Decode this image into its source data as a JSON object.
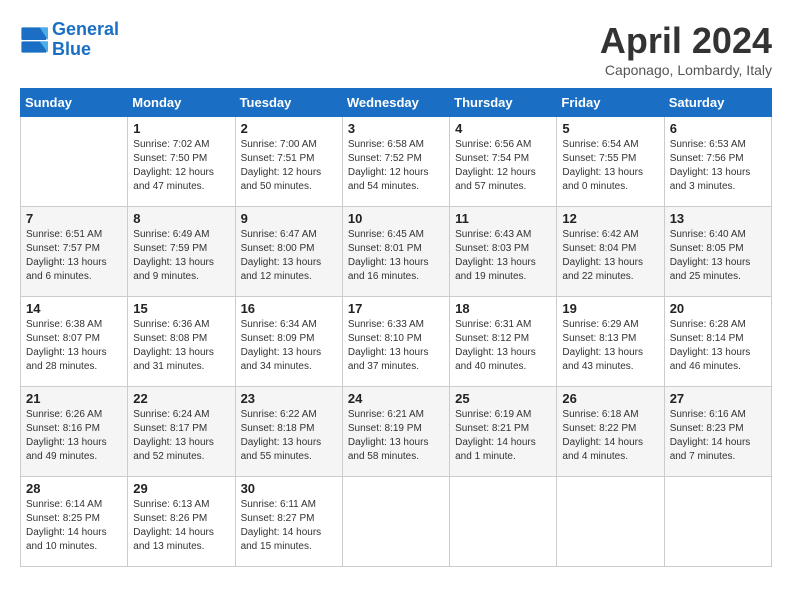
{
  "header": {
    "logo_line1": "General",
    "logo_line2": "Blue",
    "month": "April 2024",
    "location": "Caponago, Lombardy, Italy"
  },
  "weekdays": [
    "Sunday",
    "Monday",
    "Tuesday",
    "Wednesday",
    "Thursday",
    "Friday",
    "Saturday"
  ],
  "weeks": [
    [
      {
        "day": "",
        "info": ""
      },
      {
        "day": "1",
        "info": "Sunrise: 7:02 AM\nSunset: 7:50 PM\nDaylight: 12 hours\nand 47 minutes."
      },
      {
        "day": "2",
        "info": "Sunrise: 7:00 AM\nSunset: 7:51 PM\nDaylight: 12 hours\nand 50 minutes."
      },
      {
        "day": "3",
        "info": "Sunrise: 6:58 AM\nSunset: 7:52 PM\nDaylight: 12 hours\nand 54 minutes."
      },
      {
        "day": "4",
        "info": "Sunrise: 6:56 AM\nSunset: 7:54 PM\nDaylight: 12 hours\nand 57 minutes."
      },
      {
        "day": "5",
        "info": "Sunrise: 6:54 AM\nSunset: 7:55 PM\nDaylight: 13 hours\nand 0 minutes."
      },
      {
        "day": "6",
        "info": "Sunrise: 6:53 AM\nSunset: 7:56 PM\nDaylight: 13 hours\nand 3 minutes."
      }
    ],
    [
      {
        "day": "7",
        "info": "Sunrise: 6:51 AM\nSunset: 7:57 PM\nDaylight: 13 hours\nand 6 minutes."
      },
      {
        "day": "8",
        "info": "Sunrise: 6:49 AM\nSunset: 7:59 PM\nDaylight: 13 hours\nand 9 minutes."
      },
      {
        "day": "9",
        "info": "Sunrise: 6:47 AM\nSunset: 8:00 PM\nDaylight: 13 hours\nand 12 minutes."
      },
      {
        "day": "10",
        "info": "Sunrise: 6:45 AM\nSunset: 8:01 PM\nDaylight: 13 hours\nand 16 minutes."
      },
      {
        "day": "11",
        "info": "Sunrise: 6:43 AM\nSunset: 8:03 PM\nDaylight: 13 hours\nand 19 minutes."
      },
      {
        "day": "12",
        "info": "Sunrise: 6:42 AM\nSunset: 8:04 PM\nDaylight: 13 hours\nand 22 minutes."
      },
      {
        "day": "13",
        "info": "Sunrise: 6:40 AM\nSunset: 8:05 PM\nDaylight: 13 hours\nand 25 minutes."
      }
    ],
    [
      {
        "day": "14",
        "info": "Sunrise: 6:38 AM\nSunset: 8:07 PM\nDaylight: 13 hours\nand 28 minutes."
      },
      {
        "day": "15",
        "info": "Sunrise: 6:36 AM\nSunset: 8:08 PM\nDaylight: 13 hours\nand 31 minutes."
      },
      {
        "day": "16",
        "info": "Sunrise: 6:34 AM\nSunset: 8:09 PM\nDaylight: 13 hours\nand 34 minutes."
      },
      {
        "day": "17",
        "info": "Sunrise: 6:33 AM\nSunset: 8:10 PM\nDaylight: 13 hours\nand 37 minutes."
      },
      {
        "day": "18",
        "info": "Sunrise: 6:31 AM\nSunset: 8:12 PM\nDaylight: 13 hours\nand 40 minutes."
      },
      {
        "day": "19",
        "info": "Sunrise: 6:29 AM\nSunset: 8:13 PM\nDaylight: 13 hours\nand 43 minutes."
      },
      {
        "day": "20",
        "info": "Sunrise: 6:28 AM\nSunset: 8:14 PM\nDaylight: 13 hours\nand 46 minutes."
      }
    ],
    [
      {
        "day": "21",
        "info": "Sunrise: 6:26 AM\nSunset: 8:16 PM\nDaylight: 13 hours\nand 49 minutes."
      },
      {
        "day": "22",
        "info": "Sunrise: 6:24 AM\nSunset: 8:17 PM\nDaylight: 13 hours\nand 52 minutes."
      },
      {
        "day": "23",
        "info": "Sunrise: 6:22 AM\nSunset: 8:18 PM\nDaylight: 13 hours\nand 55 minutes."
      },
      {
        "day": "24",
        "info": "Sunrise: 6:21 AM\nSunset: 8:19 PM\nDaylight: 13 hours\nand 58 minutes."
      },
      {
        "day": "25",
        "info": "Sunrise: 6:19 AM\nSunset: 8:21 PM\nDaylight: 14 hours\nand 1 minute."
      },
      {
        "day": "26",
        "info": "Sunrise: 6:18 AM\nSunset: 8:22 PM\nDaylight: 14 hours\nand 4 minutes."
      },
      {
        "day": "27",
        "info": "Sunrise: 6:16 AM\nSunset: 8:23 PM\nDaylight: 14 hours\nand 7 minutes."
      }
    ],
    [
      {
        "day": "28",
        "info": "Sunrise: 6:14 AM\nSunset: 8:25 PM\nDaylight: 14 hours\nand 10 minutes."
      },
      {
        "day": "29",
        "info": "Sunrise: 6:13 AM\nSunset: 8:26 PM\nDaylight: 14 hours\nand 13 minutes."
      },
      {
        "day": "30",
        "info": "Sunrise: 6:11 AM\nSunset: 8:27 PM\nDaylight: 14 hours\nand 15 minutes."
      },
      {
        "day": "",
        "info": ""
      },
      {
        "day": "",
        "info": ""
      },
      {
        "day": "",
        "info": ""
      },
      {
        "day": "",
        "info": ""
      }
    ]
  ]
}
